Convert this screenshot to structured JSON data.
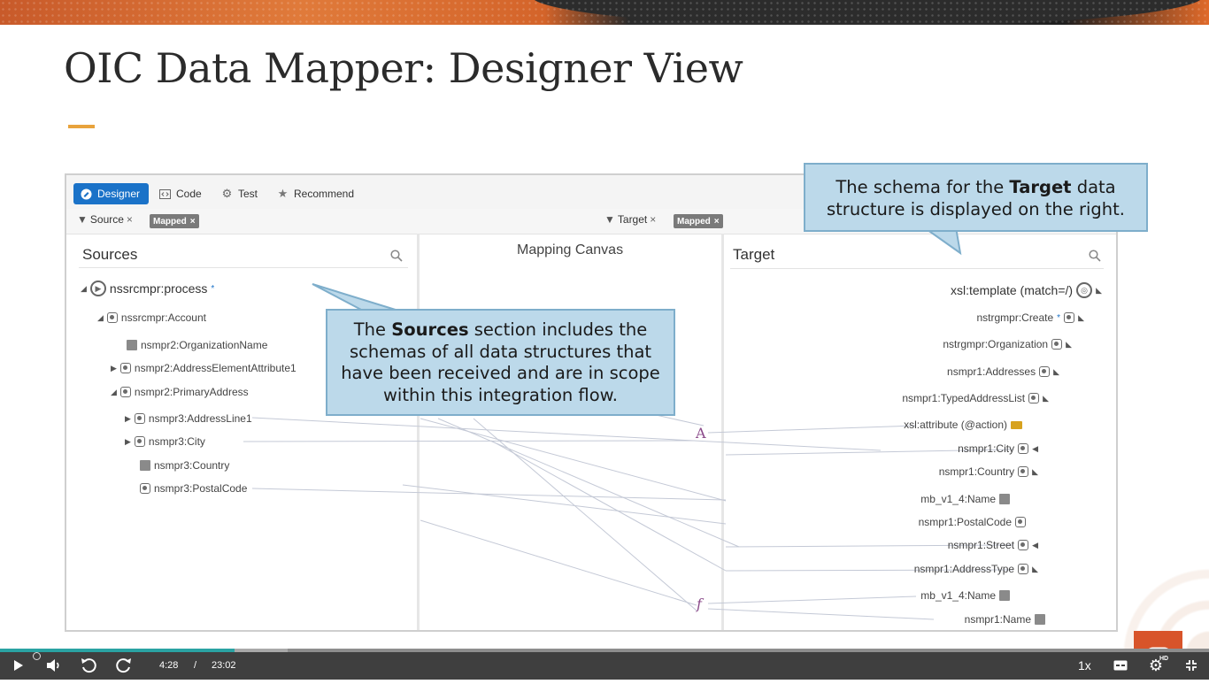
{
  "slide": {
    "title": "OIC Data Mapper: Designer View"
  },
  "toolbar": {
    "tabs": [
      {
        "label": "Designer",
        "icon": "designer-icon",
        "active": true
      },
      {
        "label": "Code",
        "icon": "code-icon"
      },
      {
        "label": "Test",
        "icon": "gear-icon"
      },
      {
        "label": "Recommend",
        "icon": "star-icon"
      }
    ]
  },
  "filters": {
    "source_label": "Source",
    "source_chip": "Mapped",
    "target_label": "Target",
    "target_chip": "Mapped"
  },
  "sources": {
    "heading": "Sources",
    "items": [
      {
        "label": "nssrcmpr:process",
        "star": "*",
        "icon": "process-icon",
        "expander": "expanded"
      },
      {
        "label": "nssrcmpr:Account",
        "icon": "complex-element-icon",
        "expander": "expanded"
      },
      {
        "label": "nsmpr2:OrganizationName",
        "icon": "string-icon"
      },
      {
        "label": "nsmpr2:AddressElementAttribute1",
        "icon": "element-icon",
        "expander": "collapsed"
      },
      {
        "label": "nsmpr2:PrimaryAddress",
        "icon": "element-icon",
        "expander": "expanded"
      },
      {
        "label": "nsmpr3:AddressLine1",
        "icon": "element-icon",
        "expander": "collapsed"
      },
      {
        "label": "nsmpr3:City",
        "icon": "element-icon",
        "expander": "collapsed"
      },
      {
        "label": "nsmpr3:Country",
        "icon": "string-icon"
      },
      {
        "label": "nsmpr3:PostalCode",
        "icon": "element-icon"
      }
    ]
  },
  "canvas": {
    "heading": "Mapping Canvas",
    "marks": [
      "A",
      "f"
    ]
  },
  "target": {
    "heading": "Target",
    "items": [
      {
        "label": "xsl:template (match=/)",
        "icon": "template-icon"
      },
      {
        "label": "nstrgmpr:Create",
        "star": "*",
        "icon": "element-icon"
      },
      {
        "label": "nstrgmpr:Organization",
        "icon": "complex-element-icon"
      },
      {
        "label": "nsmpr1:Addresses",
        "icon": "element-icon"
      },
      {
        "label": "nsmpr1:TypedAddressList",
        "icon": "complex-element-icon"
      },
      {
        "label": "xsl:attribute (@action)",
        "icon": "xyz-icon"
      },
      {
        "label": "nsmpr1:City",
        "icon": "element-icon"
      },
      {
        "label": "nsmpr1:Country",
        "icon": "element-icon"
      },
      {
        "label": "mb_v1_4:Name",
        "icon": "string-icon"
      },
      {
        "label": "nsmpr1:PostalCode",
        "icon": "element-icon"
      },
      {
        "label": "nsmpr1:Street",
        "icon": "element-icon"
      },
      {
        "label": "nsmpr1:AddressType",
        "icon": "element-icon"
      },
      {
        "label": "mb_v1_4:Name",
        "icon": "string-icon"
      },
      {
        "label": "nsmpr1:Name",
        "icon": "string-icon"
      }
    ]
  },
  "callouts": {
    "sources_pre": "The ",
    "sources_bold": "Sources",
    "sources_post": " section includes the schemas of all data structures that have been received and are in scope within this integration flow.",
    "target_pre": "The schema for the ",
    "target_bold": "Target",
    "target_post": " data structure is displayed on the right."
  },
  "player": {
    "current_time": "4:28",
    "separator": "/",
    "duration": "23:02",
    "speed": "1x",
    "progress_fraction": 0.194,
    "quality_badge": "HD"
  },
  "colors": {
    "accent_blue": "#1a72c8",
    "callout_fill": "#bcd9ea",
    "title_accent": "#e8a33c",
    "player_progress": "#2aa3a3"
  }
}
